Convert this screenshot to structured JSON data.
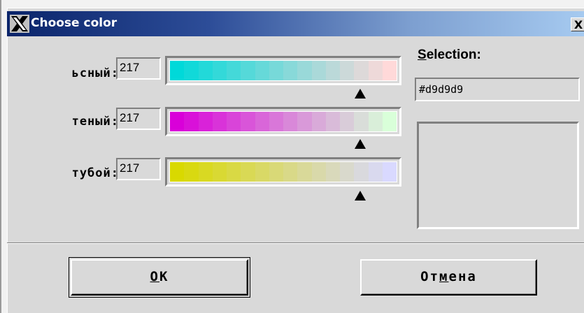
{
  "window": {
    "title": "Choose color",
    "close_label": "X"
  },
  "rows": [
    {
      "label": "ьсный:",
      "value": "217",
      "marker_fraction": 0.85
    },
    {
      "label": "теный:",
      "value": "217",
      "marker_fraction": 0.85
    },
    {
      "label": "тубой:",
      "value": "217",
      "marker_fraction": 0.85
    }
  ],
  "gradients": {
    "red": {
      "from": "#00d9d9",
      "to": "#ffd9d9"
    },
    "green": {
      "from": "#d900d9",
      "to": "#d9ffd9"
    },
    "blue": {
      "from": "#d9d900",
      "to": "#d9d9ff"
    }
  },
  "selection": {
    "label_prefix": "S",
    "label_rest": "election:",
    "hex_value": "#d9d9d9",
    "preview_color": "#d9d9d9"
  },
  "buttons": {
    "ok_mnemonic": "O",
    "ok_rest": "K",
    "cancel_prefix": "От",
    "cancel_mnemonic": "м",
    "cancel_rest": "ена"
  },
  "icons": {
    "title_icon": "x-window-logo-icon",
    "close_icon": "close-icon"
  }
}
